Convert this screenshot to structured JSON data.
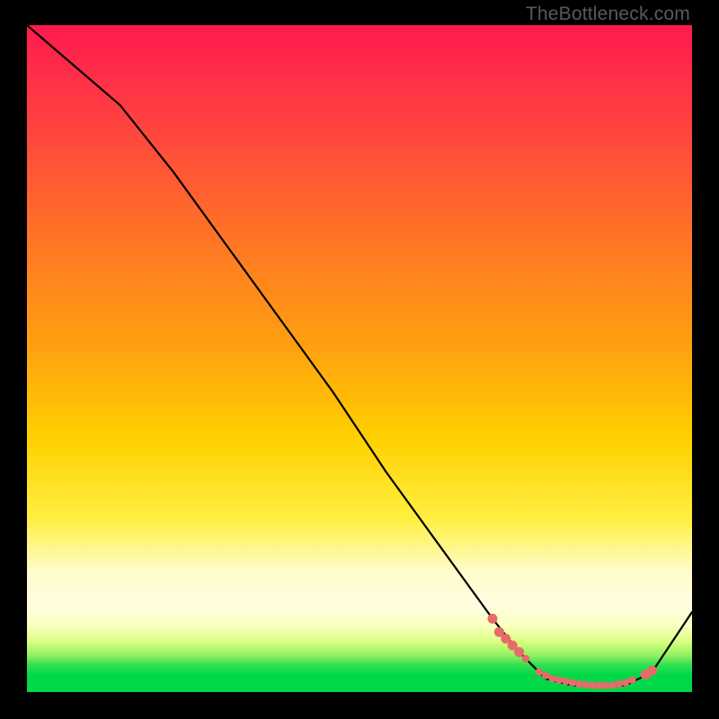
{
  "watermark": "TheBottleneck.com",
  "chart_data": {
    "type": "line",
    "title": "",
    "xlabel": "",
    "ylabel": "",
    "xlim": [
      0,
      100
    ],
    "ylim": [
      0,
      100
    ],
    "series": [
      {
        "name": "bottleneck-curve",
        "x": [
          0,
          7,
          14,
          22,
          30,
          38,
          46,
          54,
          62,
          70,
          74,
          78,
          82,
          86,
          90,
          94,
          100
        ],
        "values": [
          100,
          94,
          88,
          78,
          67,
          56,
          45,
          33,
          22,
          11,
          6,
          2,
          1,
          1,
          1,
          3,
          12
        ]
      },
      {
        "name": "highlight-dots",
        "x": [
          70,
          71,
          72,
          73,
          74,
          75,
          77,
          78,
          79,
          80,
          81,
          82,
          83,
          84,
          85,
          86,
          87,
          88,
          89,
          90,
          91,
          93,
          94
        ],
        "values": [
          11,
          9,
          8,
          7,
          6,
          5,
          3,
          2.5,
          2,
          1.8,
          1.6,
          1.4,
          1.2,
          1.1,
          1,
          1,
          1,
          1,
          1.2,
          1.4,
          1.8,
          2.6,
          3.2
        ]
      }
    ],
    "colors": {
      "curve": "#000000",
      "dots": "#e66b6b",
      "gradient_top": "#ff1a4d",
      "gradient_mid": "#ffd000",
      "gradient_bottom": "#00d848"
    }
  }
}
